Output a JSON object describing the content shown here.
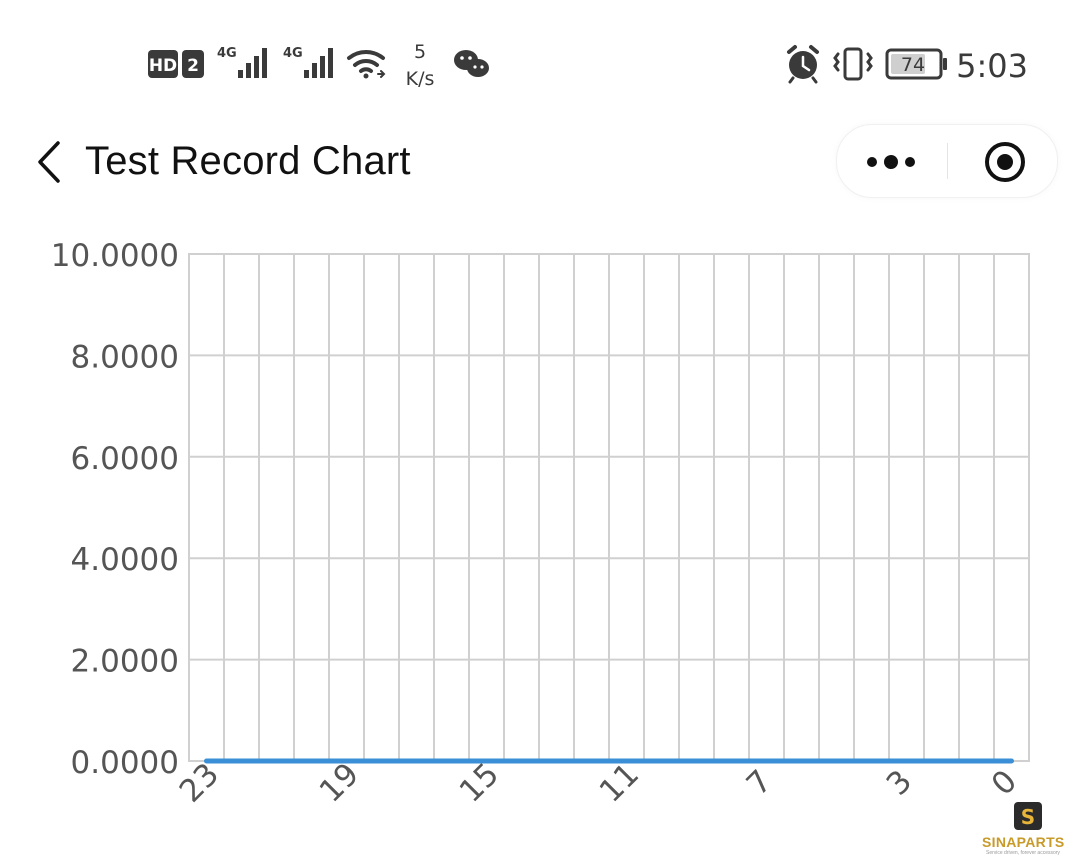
{
  "status_bar": {
    "hd_badge": "HD",
    "sim_slot": "2",
    "network_1": "4G",
    "network_2": "4G",
    "speed_value": "5",
    "speed_unit": "K/s",
    "battery_percent": "74",
    "time": "5:03",
    "icons": [
      "hd-icon",
      "signal-icon",
      "wifi-icon",
      "wechat-icon",
      "alarm-icon",
      "vibrate-icon",
      "battery-icon"
    ]
  },
  "nav": {
    "title": "Test Record Chart",
    "icons": [
      "back-arrow-icon",
      "more-dots-icon",
      "close-target-icon"
    ]
  },
  "watermark": {
    "brand": "SINAPARTS",
    "tagline": "Service driven, forever accessory"
  },
  "chart_data": {
    "type": "line",
    "title": "",
    "xlabel": "",
    "ylabel": "",
    "ylim": [
      0,
      10
    ],
    "y_ticks": [
      "10.0000",
      "8.0000",
      "6.0000",
      "4.0000",
      "2.0000",
      "0.0000"
    ],
    "x_tick_labels": [
      "23",
      "19",
      "15",
      "11",
      "7",
      "3",
      "0"
    ],
    "x": [
      23,
      22,
      21,
      20,
      19,
      18,
      17,
      16,
      15,
      14,
      13,
      12,
      11,
      10,
      9,
      8,
      7,
      6,
      5,
      4,
      3,
      2,
      1,
      0
    ],
    "series": [
      {
        "values": [
          0,
          0,
          0,
          0,
          0,
          0,
          0,
          0,
          0,
          0,
          0,
          0,
          0,
          0,
          0,
          0,
          0,
          0,
          0,
          0,
          0,
          0,
          0,
          0
        ],
        "color": "#3a8fd6"
      }
    ],
    "grid": true,
    "grid_color": "#d0d0d0"
  }
}
